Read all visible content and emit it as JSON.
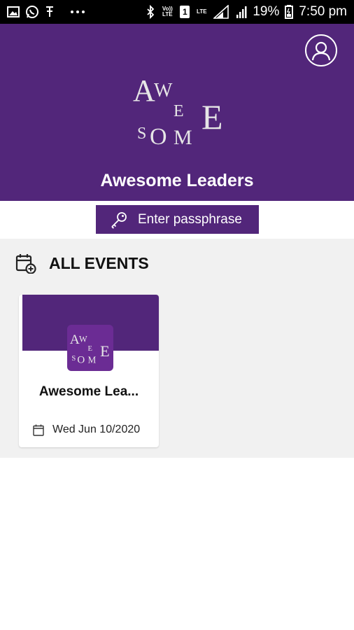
{
  "status_bar": {
    "icons": [
      "gallery-icon",
      "whatsapp-icon",
      "app-icon",
      "more-dots-icon",
      "bluetooth-icon",
      "volte-icon",
      "sim-icon",
      "lte-icon",
      "signal-icon"
    ],
    "volte_label": "Vo)) LTE",
    "lte_label": "LTE",
    "sim_label": "1",
    "battery": "19%",
    "time": "7:50 pm"
  },
  "header": {
    "logo_lines": [
      "AWE",
      "SOME"
    ],
    "title": "Awesome Leaders",
    "background": "#52267a"
  },
  "passphrase": {
    "label": "Enter passphrase",
    "icon": "key-icon"
  },
  "events": {
    "title": "ALL EVENTS",
    "icon": "calendar-add-icon",
    "items": [
      {
        "title": "Awesome Lea...",
        "date": "Wed Jun 10/2020",
        "logo_lines": [
          "AWE",
          "SOME"
        ]
      }
    ]
  }
}
